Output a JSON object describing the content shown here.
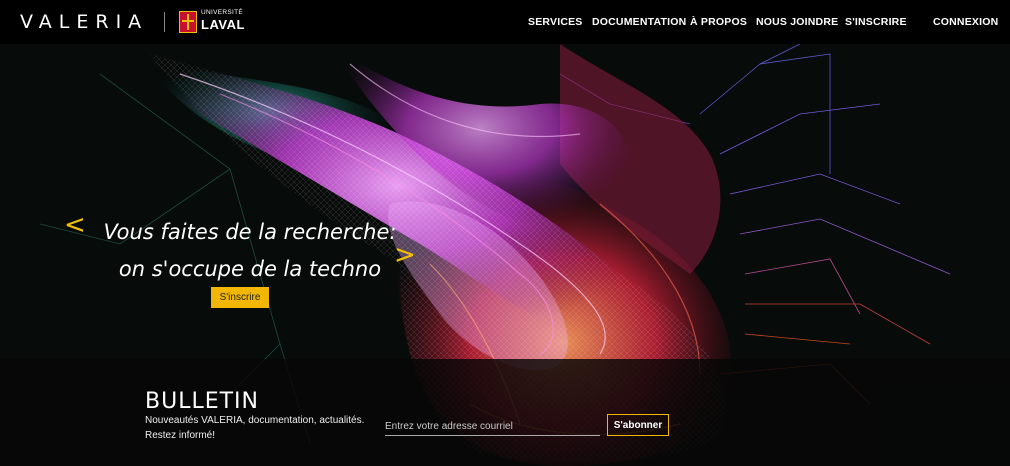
{
  "brand": {
    "logo_text": "VALERIA",
    "partner_small": "UNIVERSITÉ",
    "partner_big": "LAVAL"
  },
  "nav": {
    "services": "SERVICES",
    "documentation": "DOCUMENTATION",
    "a_propos": "À PROPOS",
    "nous_joindre": "NOUS JOINDRE",
    "s_inscrire": "S'INSCRIRE",
    "connexion": "CONNEXION"
  },
  "hero": {
    "line1": "Vous faites de la recherche:",
    "line2": "on s'occupe de la techno",
    "cta_label": "S'inscrire",
    "prev_glyph": "<",
    "next_glyph": ">"
  },
  "bulletin": {
    "title": "BULLETIN",
    "description": "Nouveautés VALERIA, documentation, actualités. Restez informé!",
    "email_placeholder": "Entrez votre adresse courriel",
    "subscribe_label": "S'abonner"
  },
  "colors": {
    "accent": "#f2b705",
    "background": "#070b0a",
    "header": "#000000"
  }
}
